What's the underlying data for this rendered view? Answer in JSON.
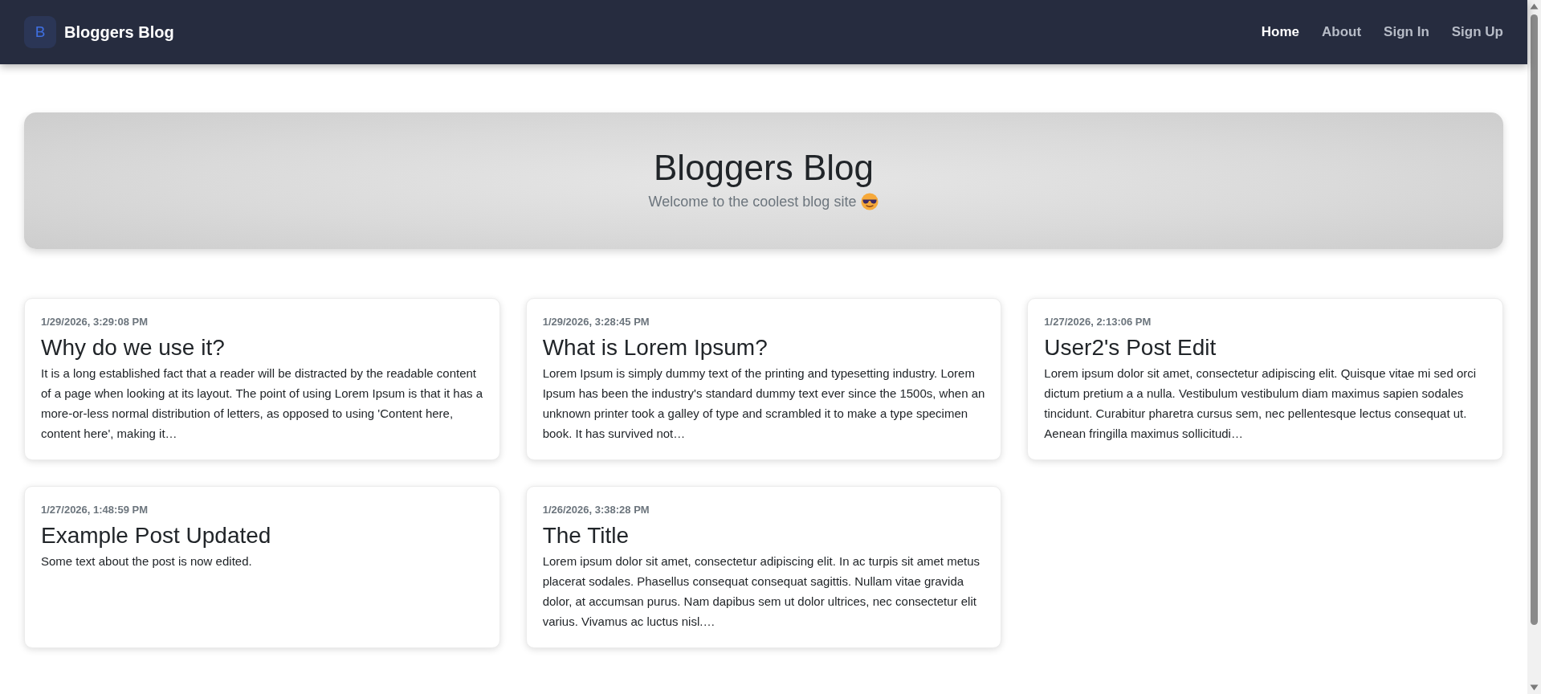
{
  "navbar": {
    "logo": "B",
    "brand": "Bloggers Blog",
    "links": [
      {
        "label": "Home",
        "selected": true
      },
      {
        "label": "About",
        "selected": false
      },
      {
        "label": "Sign In",
        "selected": false
      },
      {
        "label": "Sign Up",
        "selected": false
      }
    ]
  },
  "hero": {
    "title": "Bloggers Blog",
    "subtitle": "Welcome to the coolest blog site"
  },
  "posts": [
    {
      "date": "1/29/2026, 3:29:08 PM",
      "title": "Why do we use it?",
      "excerpt": "It is a long established fact that a reader will be distracted by the readable content of a page when looking at its layout. The point of using Lorem Ipsum is that it has a more-or-less normal distribution of letters, as opposed to using 'Content here, content here', making it…"
    },
    {
      "date": "1/29/2026, 3:28:45 PM",
      "title": "What is Lorem Ipsum?",
      "excerpt": "Lorem Ipsum is simply dummy text of the printing and typesetting industry. Lorem Ipsum has been the industry's standard dummy text ever since the 1500s, when an unknown printer took a galley of type and scrambled it to make a type specimen book. It has survived not…"
    },
    {
      "date": "1/27/2026, 2:13:06 PM",
      "title": "User2's Post Edit",
      "excerpt": "Lorem ipsum dolor sit amet, consectetur adipiscing elit. Quisque vitae mi sed orci dictum pretium a a nulla. Vestibulum vestibulum diam maximus sapien sodales tincidunt. Curabitur pharetra cursus sem, nec pellentesque lectus consequat ut. Aenean fringilla maximus sollicitudi…"
    },
    {
      "date": "1/27/2026, 1:48:59 PM",
      "title": "Example Post Updated",
      "excerpt": "Some text about the post is now edited."
    },
    {
      "date": "1/26/2026, 3:38:28 PM",
      "title": "The Title",
      "excerpt": "Lorem ipsum dolor sit amet, consectetur adipiscing elit. In ac turpis sit amet metus placerat sodales. Phasellus consequat consequat sagittis. Nullam vitae gravida dolor, at accumsan purus. Nam dapibus sem ut dolor ultrices, nec consectetur elit varius. Vivamus ac luctus nisl.…"
    }
  ]
}
